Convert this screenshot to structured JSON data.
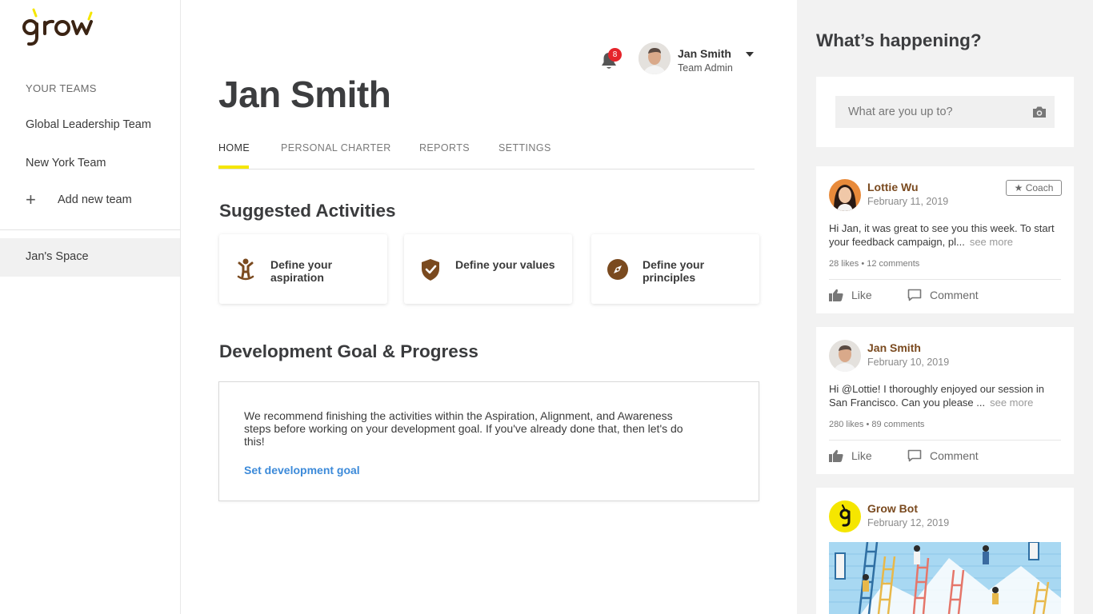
{
  "sidebar": {
    "logo_text": "grow",
    "teams_label": "YOUR TEAMS",
    "teams": [
      "Global Leadership Team",
      "New York Team"
    ],
    "add_team_label": "Add new team",
    "space_label": "Jan's Space"
  },
  "header": {
    "notification_count": "8",
    "user_name": "Jan Smith",
    "user_role": "Team Admin"
  },
  "main": {
    "page_title": "Jan Smith",
    "tabs": [
      "HOME",
      "PERSONAL CHARTER",
      "REPORTS",
      "SETTINGS"
    ],
    "active_tab": "HOME",
    "suggested_title": "Suggested Activities",
    "activities": [
      {
        "label": "Define your aspiration",
        "icon": "aspiration-icon"
      },
      {
        "label": "Define your values",
        "icon": "shield-check-icon"
      },
      {
        "label": "Define your principles",
        "icon": "compass-icon"
      }
    ],
    "goal_title": "Development Goal & Progress",
    "goal_text": "We recommend finishing the activities within the Aspiration, Alignment, and Awareness steps before working on your development goal. If you've already done that, then let's do this!",
    "goal_link": "Set development goal"
  },
  "feed": {
    "title": "What’s happening?",
    "compose_placeholder": "What are you up to?",
    "posts": [
      {
        "author": "Lottie Wu",
        "date": "February 11, 2019",
        "badge": "★ Coach",
        "text": "Hi Jan, it was great to see you this week. To start your feedback campaign, pl...",
        "see_more": "see more",
        "stats": "28 likes • 12 comments",
        "like_label": "Like",
        "comment_label": "Comment"
      },
      {
        "author": "Jan Smith",
        "date": "February 10, 2019",
        "text": "Hi @Lottie! I thoroughly enjoyed our session in San Francisco. Can you please ...",
        "see_more": "see more",
        "stats": "280 likes • 89 comments",
        "like_label": "Like",
        "comment_label": "Comment"
      },
      {
        "author": "Grow Bot",
        "date": "February 12, 2019"
      }
    ]
  },
  "colors": {
    "brand_yellow": "#f5e600",
    "brand_brown": "#7a4a1f",
    "link_blue": "#3c8ad9",
    "badge_red": "#e5242b"
  }
}
